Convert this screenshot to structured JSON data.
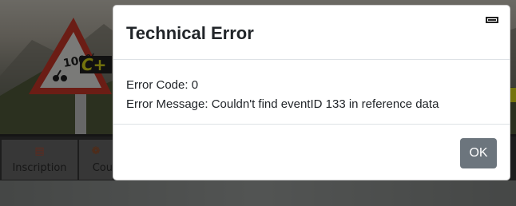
{
  "background": {
    "banner_text": "100%",
    "nav": [
      {
        "label": "Inscription",
        "icon": "document-icon"
      },
      {
        "label": "Cou",
        "icon": "cyclist-icon"
      }
    ]
  },
  "modal": {
    "title": "Technical Error",
    "close_icon": "close-icon",
    "error_code_line": "Error Code: 0",
    "error_message_line": "Error Message: Couldn't find eventID 133 in reference data",
    "ok_label": "OK"
  },
  "colors": {
    "ok_button": "#6c757d",
    "nav_bg": "#3b3b3b",
    "nav_item": "#6f6f6f",
    "sign_red": "#d63a2a",
    "logo_yellow": "#e8e61a"
  }
}
